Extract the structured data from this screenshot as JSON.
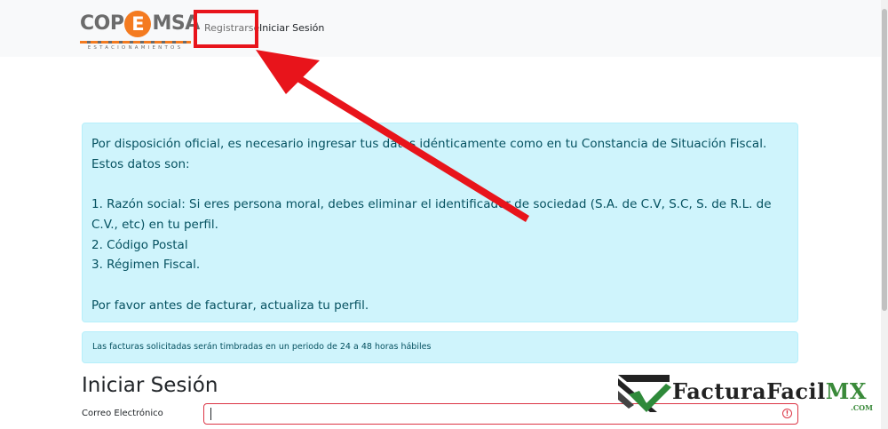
{
  "navbar": {
    "logo": {
      "brand": "COPEMSA",
      "left_text": "COP",
      "e_letter": "E",
      "right_text": "MSA",
      "tagline": "ESTACIONAMIENTOS"
    },
    "links": {
      "register": "Registrarse",
      "login": "Iniciar Sesión"
    }
  },
  "alert_main": {
    "line1": "Por disposición oficial, es necesario ingresar tus datos idénticamente como en tu Constancia de Situación Fiscal.",
    "line2": "Estos datos son:",
    "item1a": "1. Razón social: Si eres persona moral, debes eliminar el identificador de sociedad (S.A. de C.V, S.C, S. de R.L. de",
    "item1b": "C.V., etc) en tu perfil.",
    "item2": "2. Código Postal",
    "item3": "3. Régimen Fiscal.",
    "closing": "Por favor antes de facturar, actualiza tu perfil."
  },
  "alert_small": {
    "text": "Las facturas solicitadas serán timbradas en un periodo de 24 a 48 horas hábiles"
  },
  "login": {
    "title": "Iniciar Sesión",
    "email_label": "Correo Electrónico",
    "email_value": ""
  },
  "watermark": {
    "name": "FacturaFacil",
    "suffix": "MX",
    "domain": ".COM"
  },
  "icons": {
    "invalid": "exclamation-circle-icon",
    "arrow": "red-annotation-arrow"
  },
  "colors": {
    "alert_bg": "#cff4fc",
    "alert_text": "#055160",
    "annotation_red": "#e8141b",
    "logo_orange": "#f47b20",
    "invalid_red": "#dc3545"
  }
}
